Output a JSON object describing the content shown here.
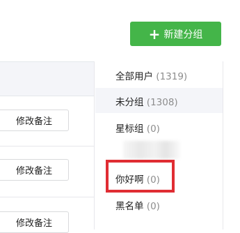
{
  "toolbar": {
    "new_group_button": {
      "icon": "plus-icon",
      "icon_glyph": "+",
      "label": "新建分组",
      "color": "#44b549"
    }
  },
  "table": {
    "rows": [
      {
        "remark_button": "修改备注"
      },
      {
        "remark_button": "修改备注"
      },
      {
        "remark_button": "修改备注"
      }
    ]
  },
  "groups": {
    "items": [
      {
        "label": "全部用户",
        "count": "(1319)"
      },
      {
        "label": "未分组",
        "count": "(1308)",
        "selected": true
      },
      {
        "label": "星标组",
        "count": "(0)"
      },
      {
        "label": "你好啊",
        "count": "(0)",
        "highlighted": true,
        "highlight_color": "#e02d33"
      },
      {
        "label": "黑名单",
        "count": "(0)"
      }
    ]
  }
}
